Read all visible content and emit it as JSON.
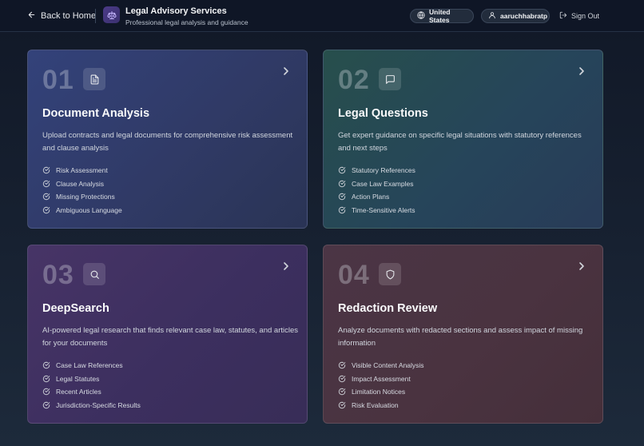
{
  "header": {
    "back_label": "Back to Home",
    "title": "Legal Advisory Services",
    "subtitle": "Professional legal analysis and guidance",
    "country": "United States",
    "username": "aaruchhabratp",
    "signout_label": "Sign Out"
  },
  "cards": [
    {
      "number": "01",
      "icon": "document-icon",
      "title": "Document Analysis",
      "description": "Upload contracts and legal documents for comprehensive risk assessment and clause analysis",
      "features": [
        "Risk Assessment",
        "Clause Analysis",
        "Missing Protections",
        "Ambiguous Language"
      ]
    },
    {
      "number": "02",
      "icon": "chat-bubble-icon",
      "title": "Legal Questions",
      "description": "Get expert guidance on specific legal situations with statutory references and next steps",
      "features": [
        "Statutory References",
        "Case Law Examples",
        "Action Plans",
        "Time-Sensitive Alerts"
      ]
    },
    {
      "number": "03",
      "icon": "search-icon",
      "title": "DeepSearch",
      "description": "AI-powered legal research that finds relevant case law, statutes, and articles for your documents",
      "features": [
        "Case Law References",
        "Legal Statutes",
        "Recent Articles",
        "Jurisdiction-Specific Results"
      ]
    },
    {
      "number": "04",
      "icon": "shield-icon",
      "title": "Redaction Review",
      "description": "Analyze documents with redacted sections and assess impact of missing information",
      "features": [
        "Visible Content Analysis",
        "Impact Assessment",
        "Limitation Notices",
        "Risk Evaluation"
      ]
    }
  ]
}
